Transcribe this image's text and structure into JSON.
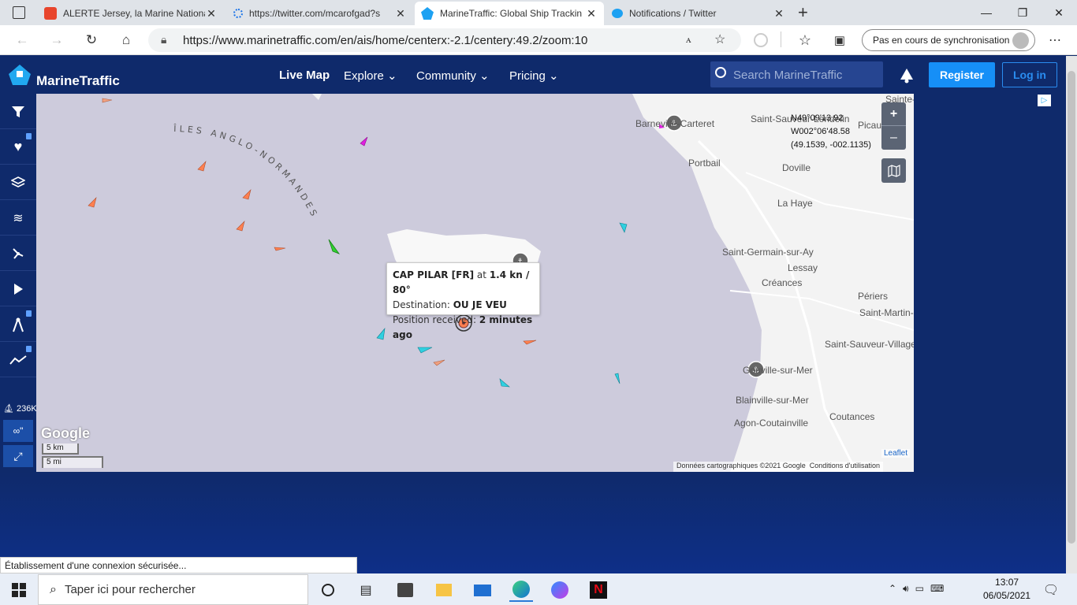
{
  "browser": {
    "tabs": [
      {
        "title": "ALERTE Jersey, la Marine Nationa",
        "icon": "ox-news-icon"
      },
      {
        "title": "https://twitter.com/mcarofgad?s",
        "icon": "loading-icon"
      },
      {
        "title": "MarineTraffic: Global Ship Trackin",
        "icon": "marinetraffic-icon"
      },
      {
        "title": "Notifications / Twitter",
        "icon": "twitter-icon"
      }
    ],
    "url": "https://www.marinetraffic.com/en/ais/home/centerx:-2.1/centery:49.2/zoom:10",
    "sync_label": "Pas en cours de synchronisation"
  },
  "site": {
    "brand": "MarineTraffic",
    "nav": {
      "live_map": "Live Map",
      "explore": "Explore",
      "community": "Community",
      "pricing": "Pricing"
    },
    "search_placeholder": "Search MarineTraffic",
    "register": "Register",
    "login": "Log in",
    "accent": "#168ff7",
    "header_bg": "#0f2a6b"
  },
  "sidebar": {
    "vessel_count": "236K",
    "track_label": "∞\""
  },
  "map": {
    "area_label": "ÎLES ANGLO-NORMANDES",
    "coords": {
      "lat": "N49°09'13.92",
      "lon": "W002°06'48.58",
      "decimal": "(49.1539, -002.1135)"
    },
    "towns": [
      {
        "name": "Barneville-Carteret",
        "key": "barneville"
      },
      {
        "name": "Saint-Sauveur-Lendelin",
        "key": "ssl"
      },
      {
        "name": "Portbail"
      },
      {
        "name": "Doville"
      },
      {
        "name": "La Haye"
      },
      {
        "name": "Saint-Germain-sur-Ay"
      },
      {
        "name": "Lessay"
      },
      {
        "name": "Créances"
      },
      {
        "name": "Périers"
      },
      {
        "name": "Saint-Martin-d"
      },
      {
        "name": "Saint-Sauveur-Villages"
      },
      {
        "name": "Gouville-sur-Mer"
      },
      {
        "name": "Blainville-sur-Mer"
      },
      {
        "name": "Coutances"
      },
      {
        "name": "Agon-Coutainville"
      },
      {
        "name": "Picauville"
      },
      {
        "name": "Sainte-"
      }
    ],
    "popup": {
      "vessel": "CAP PILAR [FR]",
      "at": "at",
      "speed": "1.4 kn / 80°",
      "destination_label": "Destination:",
      "destination": "OU JE VEU",
      "received_label": "Position received:",
      "received": "2 minutes ago"
    },
    "scale": {
      "km": "5 km",
      "mi": "5 mi"
    },
    "attribution": "Données cartographiques ©2021 Google",
    "terms": "Conditions d'utilisation",
    "leaflet": "Leaflet",
    "google": "Google",
    "sea_color": "#cdcbdc"
  },
  "status_text": "Établissement d'une connexion sécurisée...",
  "taskbar": {
    "search_placeholder": "Taper ici pour rechercher",
    "time": "13:07",
    "date": "06/05/2021"
  }
}
